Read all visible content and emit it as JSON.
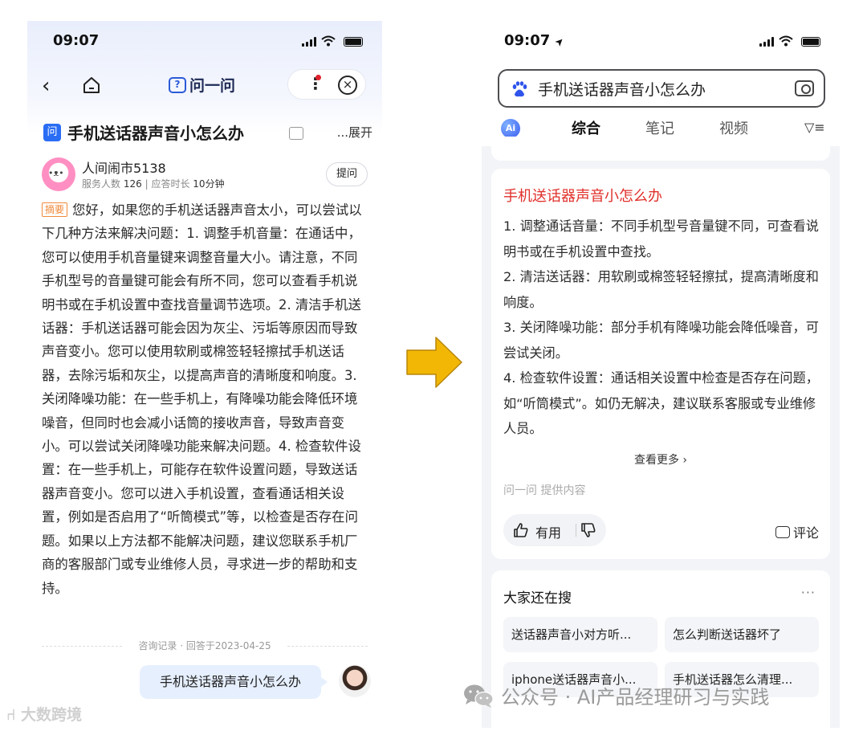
{
  "left_phone": {
    "status_time": "09:07",
    "nav": {
      "brand_logo": "?",
      "brand_name": "问一问",
      "more_icon": "⋮",
      "close_icon": "×"
    },
    "question": {
      "badge": "问",
      "title": "手机送话器声音小怎么办",
      "expand": "...展开"
    },
    "author": {
      "name": "人间闹市5138",
      "served_label": "服务人数",
      "served_count": "126",
      "separator": "|",
      "response_label": "应答时长",
      "response_time": "10分钟",
      "ask_button": "提问"
    },
    "answer": {
      "tag": "摘要",
      "text": "您好，如果您的手机送话器声音太小，可以尝试以下几种方法来解决问题：1. 调整手机音量：在通话中，您可以使用手机音量键来调整音量大小。请注意，不同手机型号的音量键可能会有所不同，您可以查看手机说明书或在手机设置中查找音量调节选项。2. 清洁手机送话器：手机送话器可能会因为灰尘、污垢等原因而导致声音变小。您可以使用软刷或棉签轻轻擦拭手机送话器，去除污垢和灰尘，以提高声音的清晰度和响度。3. 关闭降噪功能：在一些手机上，有降噪功能会降低环境噪音，但同时也会减小话筒的接收声音，导致声音变小。可以尝试关闭降噪功能来解决问题。4. 检查软件设置：在一些手机上，可能存在软件设置问题，导致送话器声音变小。您可以进入手机设置，查看通话相关设置，例如是否启用了“听筒模式”等，以检查是否存在问题。如果以上方法都不能解决问题，建议您联系手机厂商的客服部门或专业维修人员，寻求进一步的帮助和支持。"
    },
    "record": "咨询记录 · 回答于2023-04-25",
    "user_bubble": "手机送话器声音小怎么办"
  },
  "watermark_left": "⑁ 大数跨境",
  "right_phone": {
    "status_time": "09:07",
    "status_arrow": "➤",
    "search": {
      "query": "手机送话器声音小怎么办"
    },
    "tabs": {
      "ai": "Ai",
      "items": [
        "综合",
        "笔记",
        "视频"
      ],
      "filter": "▽≡"
    },
    "answer_card": {
      "title": "手机送话器声音小怎么办",
      "lines": [
        "1. 调整通话音量：不同手机型号音量键不同，可查看说明书或在手机设置中查找。",
        "2. 清洁送话器：用软刷或棉签轻轻擦拭，提高清晰度和响度。",
        "3. 关闭降噪功能：部分手机有降噪功能会降低噪音，可尝试关闭。",
        "4. 检查软件设置：通话相关设置中检查是否存在问题，如“听筒模式”。如仍无解决，建议联系客服或专业维修人员。"
      ],
      "more": "查看更多 ›",
      "source": "问一问  提供内容",
      "useful": "有用",
      "comment": "评论"
    },
    "related": {
      "title": "大家还在搜",
      "more": "···",
      "chips": [
        "送话器声音小对方听...",
        "怎么判断送话器坏了",
        "iphone送话器声音小...",
        "手机送话器怎么清理..."
      ]
    }
  },
  "watermark_right": "公众号 · AI产品经理研习与实践",
  "colors": {
    "accent_blue": "#2a6df4",
    "title_red": "#e0302b",
    "arrow_gold": "#f2b705",
    "summary_orange": "#f08a3a"
  }
}
